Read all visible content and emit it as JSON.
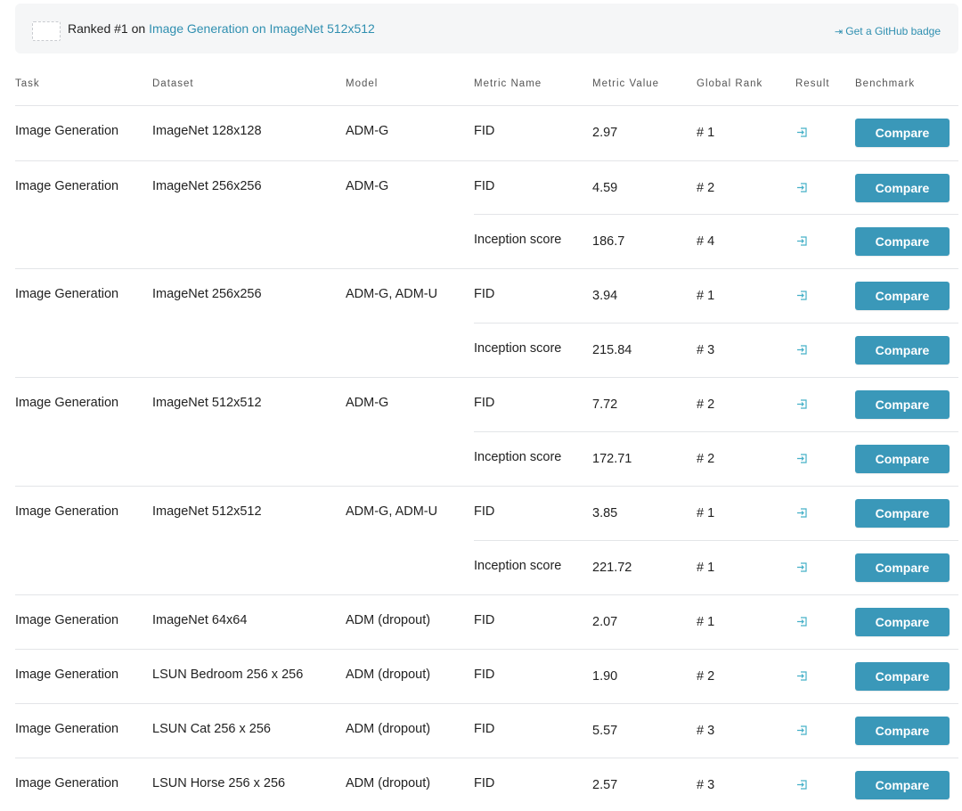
{
  "banner": {
    "prefix": "Ranked #1 on ",
    "link": "Image Generation on ImageNet 512x512",
    "badge": "Get a GitHub badge"
  },
  "table": {
    "headers": [
      "Task",
      "Dataset",
      "Model",
      "Metric Name",
      "Metric Value",
      "Global Rank",
      "Result",
      "Benchmark"
    ],
    "rows": [
      {
        "task": "Image Generation",
        "dataset": "ImageNet 128x128",
        "model": "ADM-G",
        "metric": "FID",
        "value": "2.97",
        "rank": "# 1",
        "button": "Compare"
      },
      {
        "task": "Image Generation",
        "dataset": "ImageNet 256x256",
        "model": "ADM-G",
        "metric": "FID",
        "value": "4.59",
        "rank": "# 2",
        "button": "Compare"
      },
      {
        "task": "",
        "dataset": "",
        "model": "",
        "metric": "Inception score",
        "value": "186.7",
        "rank": "# 4",
        "button": "Compare"
      },
      {
        "task": "Image Generation",
        "dataset": "ImageNet 256x256",
        "model": "ADM-G, ADM-U",
        "metric": "FID",
        "value": "3.94",
        "rank": "# 1",
        "button": "Compare"
      },
      {
        "task": "",
        "dataset": "",
        "model": "",
        "metric": "Inception score",
        "value": "215.84",
        "rank": "# 3",
        "button": "Compare"
      },
      {
        "task": "Image Generation",
        "dataset": "ImageNet 512x512",
        "model": "ADM-G",
        "metric": "FID",
        "value": "7.72",
        "rank": "# 2",
        "button": "Compare"
      },
      {
        "task": "",
        "dataset": "",
        "model": "",
        "metric": "Inception score",
        "value": "172.71",
        "rank": "# 2",
        "button": "Compare"
      },
      {
        "task": "Image Generation",
        "dataset": "ImageNet 512x512",
        "model": "ADM-G, ADM-U",
        "metric": "FID",
        "value": "3.85",
        "rank": "# 1",
        "button": "Compare"
      },
      {
        "task": "",
        "dataset": "",
        "model": "",
        "metric": "Inception score",
        "value": "221.72",
        "rank": "# 1",
        "button": "Compare"
      },
      {
        "task": "Image Generation",
        "dataset": "ImageNet 64x64",
        "model": "ADM (dropout)",
        "metric": "FID",
        "value": "2.07",
        "rank": "# 1",
        "button": "Compare"
      },
      {
        "task": "Image Generation",
        "dataset": "LSUN Bedroom 256 x 256",
        "model": "ADM (dropout)",
        "metric": "FID",
        "value": "1.90",
        "rank": "# 2",
        "button": "Compare"
      },
      {
        "task": "Image Generation",
        "dataset": "LSUN Cat 256 x 256",
        "model": "ADM (dropout)",
        "metric": "FID",
        "value": "5.57",
        "rank": "# 3",
        "button": "Compare"
      },
      {
        "task": "Image Generation",
        "dataset": "LSUN Horse 256 x 256",
        "model": "ADM (dropout)",
        "metric": "FID",
        "value": "2.57",
        "rank": "# 3",
        "button": "Compare"
      }
    ]
  },
  "icons": {
    "result": "result-link-icon",
    "badge": "badge-arrow-icon"
  },
  "colors": {
    "accent": "#3a98b9",
    "link": "#2f8fb0",
    "icon": "#45b0c8"
  }
}
